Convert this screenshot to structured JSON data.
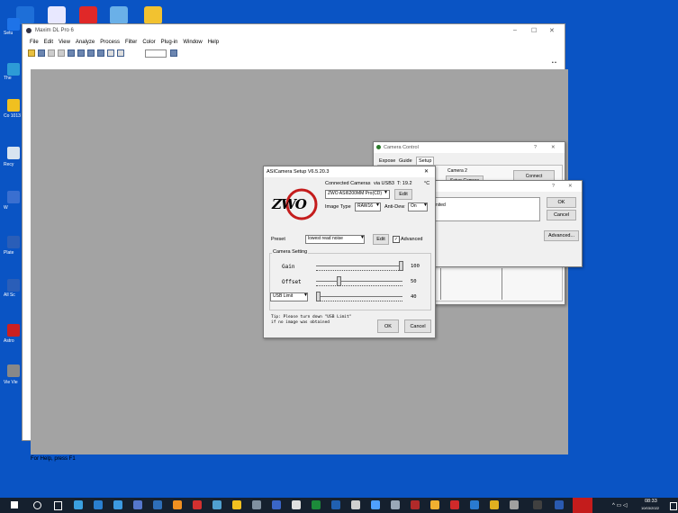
{
  "desktop": {
    "icons": [
      {
        "label": "Setu",
        "color": "#1e73e8"
      },
      {
        "label": "The",
        "color": "#2d9bd6"
      },
      {
        "label": "Co 1013",
        "color": "#f0c020"
      },
      {
        "label": "Recy",
        "color": "#d8e4f0"
      },
      {
        "label": "W",
        "color": "#3a6fd0"
      },
      {
        "label": "Plate",
        "color": "#2a5eb8"
      },
      {
        "label": "All Sc",
        "color": "#2a5eb8"
      },
      {
        "label": "Astro",
        "color": "#cc2020"
      },
      {
        "label": "Vie Vie",
        "color": "#888888"
      }
    ]
  },
  "main_window": {
    "title": "Maxim DL Pro 6",
    "controls": [
      "–",
      "☐",
      "✕"
    ],
    "menu": [
      "File",
      "Edit",
      "View",
      "Analyze",
      "Process",
      "Filter",
      "Color",
      "Plug-in",
      "Window",
      "Help"
    ],
    "status": "For Help, press F1"
  },
  "camera_control": {
    "title": "Camera Control",
    "tabs": [
      "Expose",
      "Guide",
      "Setup"
    ],
    "camera2_label": "Camera 2",
    "setup_camera": "Setup Camera",
    "connect": "Connect",
    "controls": [
      "?",
      "✕"
    ]
  },
  "small_dialog": {
    "controls": [
      "?",
      "✕"
    ],
    "text": "nited",
    "ok": "OK",
    "cancel": "Cancel",
    "advanced": "Advanced..."
  },
  "asi_setup": {
    "title": "ASICamera Setup V6.5.20.3",
    "close": "✕",
    "logo": "ZWO",
    "connected_label": "Connected Cameras",
    "usb": "via USB3",
    "temp_label": "T: 19.2",
    "temp_unit": "°C",
    "camera_name": "ZWO ASI6200MM Pro(CD)",
    "edit": "Edit",
    "image_type_label": "Image Type",
    "image_type": "RAW16",
    "antidew_label": "Anti-Dew",
    "antidew": "On",
    "preset_label": "Preset",
    "preset": "lowest read noise",
    "preset_edit": "Edit",
    "advanced_label": "Advanced",
    "group_label": "Camera Setting",
    "gain_label": "Gain",
    "gain_value": "100",
    "offset_label": "Offset",
    "offset_value": "50",
    "usb_limit_label": "USB Limit",
    "usb_limit_value": "40",
    "tip_line1": "Tip: Please turn down \"USB Limit\"",
    "tip_line2": "if no image was obtained",
    "ok": "OK",
    "cancel": "Cancel"
  },
  "taskbar": {
    "time": "08:33",
    "date": "10/03/2022"
  }
}
